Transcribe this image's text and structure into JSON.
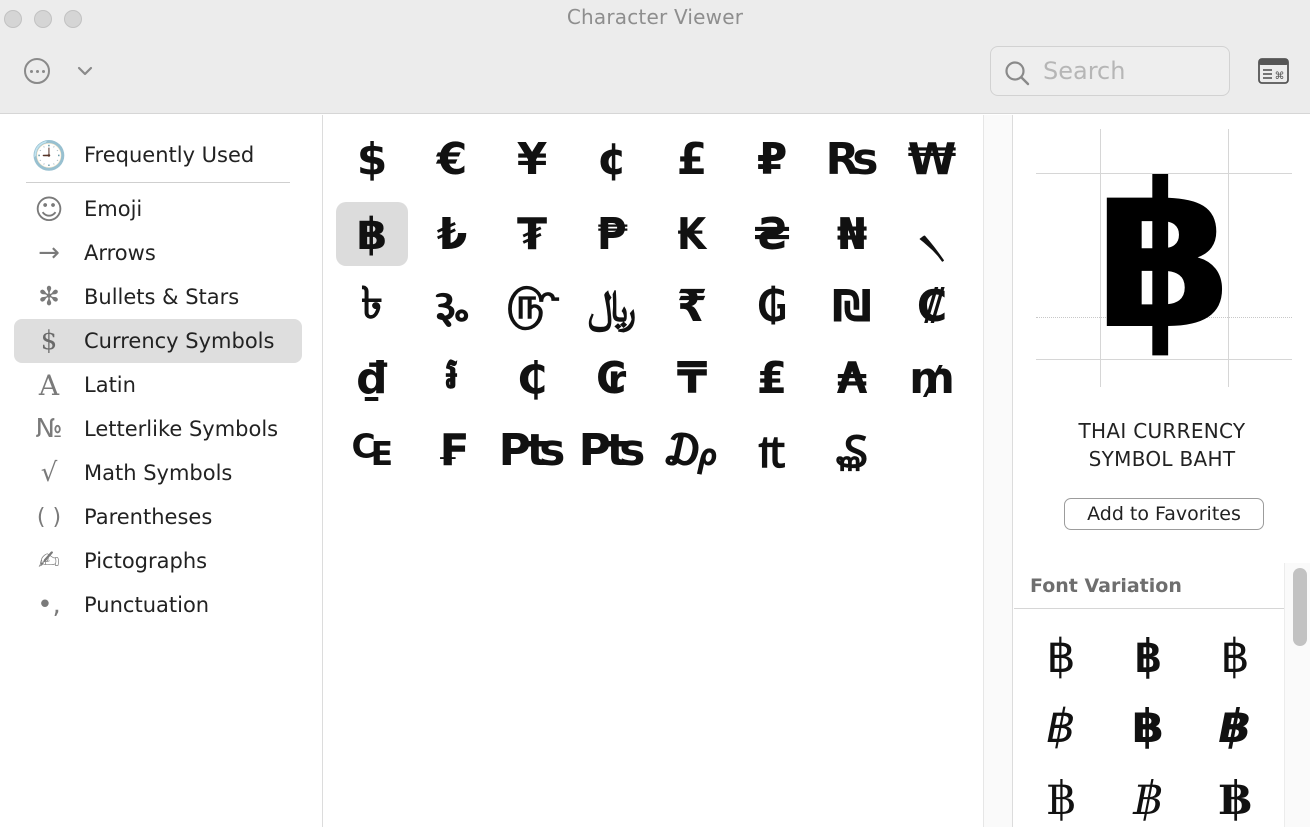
{
  "window": {
    "title": "Character Viewer"
  },
  "toolbar": {
    "search_placeholder": "Search"
  },
  "sidebar": {
    "items": [
      {
        "label": "Frequently Used",
        "icon": "clock-icon",
        "glyph": "🕘"
      },
      {
        "label": "Emoji",
        "icon": "smiley-icon",
        "glyph": "☺"
      },
      {
        "label": "Arrows",
        "icon": "arrow-right-icon",
        "glyph": "→"
      },
      {
        "label": "Bullets & Stars",
        "icon": "asterisk-icon",
        "glyph": "✻"
      },
      {
        "label": "Currency Symbols",
        "icon": "dollar-icon",
        "glyph": "$"
      },
      {
        "label": "Latin",
        "icon": "latin-a-icon",
        "glyph": "A"
      },
      {
        "label": "Letterlike Symbols",
        "icon": "numero-icon",
        "glyph": "№"
      },
      {
        "label": "Math Symbols",
        "icon": "square-root-icon",
        "glyph": "√"
      },
      {
        "label": "Parentheses",
        "icon": "parentheses-icon",
        "glyph": "( )"
      },
      {
        "label": "Pictographs",
        "icon": "writing-hand-icon",
        "glyph": "✍"
      },
      {
        "label": "Punctuation",
        "icon": "punctuation-icon",
        "glyph": "•,"
      }
    ],
    "selected": "Currency Symbols"
  },
  "grid": {
    "characters": [
      "$",
      "€",
      "¥",
      "¢",
      "£",
      "₽",
      "₨",
      "₩",
      "฿",
      "₺",
      "₮",
      "₱",
      "₭",
      "₴",
      "₦",
      "৲",
      "৳",
      "૱",
      "௹",
      "﷼",
      "₹",
      "₲",
      "₪",
      "₡",
      "₫",
      "៛",
      "₵",
      "₢",
      "₸",
      "₤",
      "₳",
      "₥",
      "₠",
      "₣",
      "₧",
      "₧",
      "₯",
      "₶",
      "₷"
    ],
    "grid_note_removed": true,
    "selected": "฿"
  },
  "detail": {
    "glyph": "฿",
    "name_line1": "THAI CURRENCY",
    "name_line2": "SYMBOL BAHT",
    "add_favorites_label": "Add to Favorites",
    "font_variation_header": "Font Variation",
    "variations": [
      "฿",
      "฿",
      "฿",
      "฿",
      "฿",
      "฿",
      "฿",
      "฿",
      "฿"
    ]
  },
  "colors": {
    "toolbar_bg": "#ececec",
    "selection_bg": "#dedede",
    "icon_gray": "#7a7a7a",
    "section_header_gray": "#6e6e6e"
  }
}
